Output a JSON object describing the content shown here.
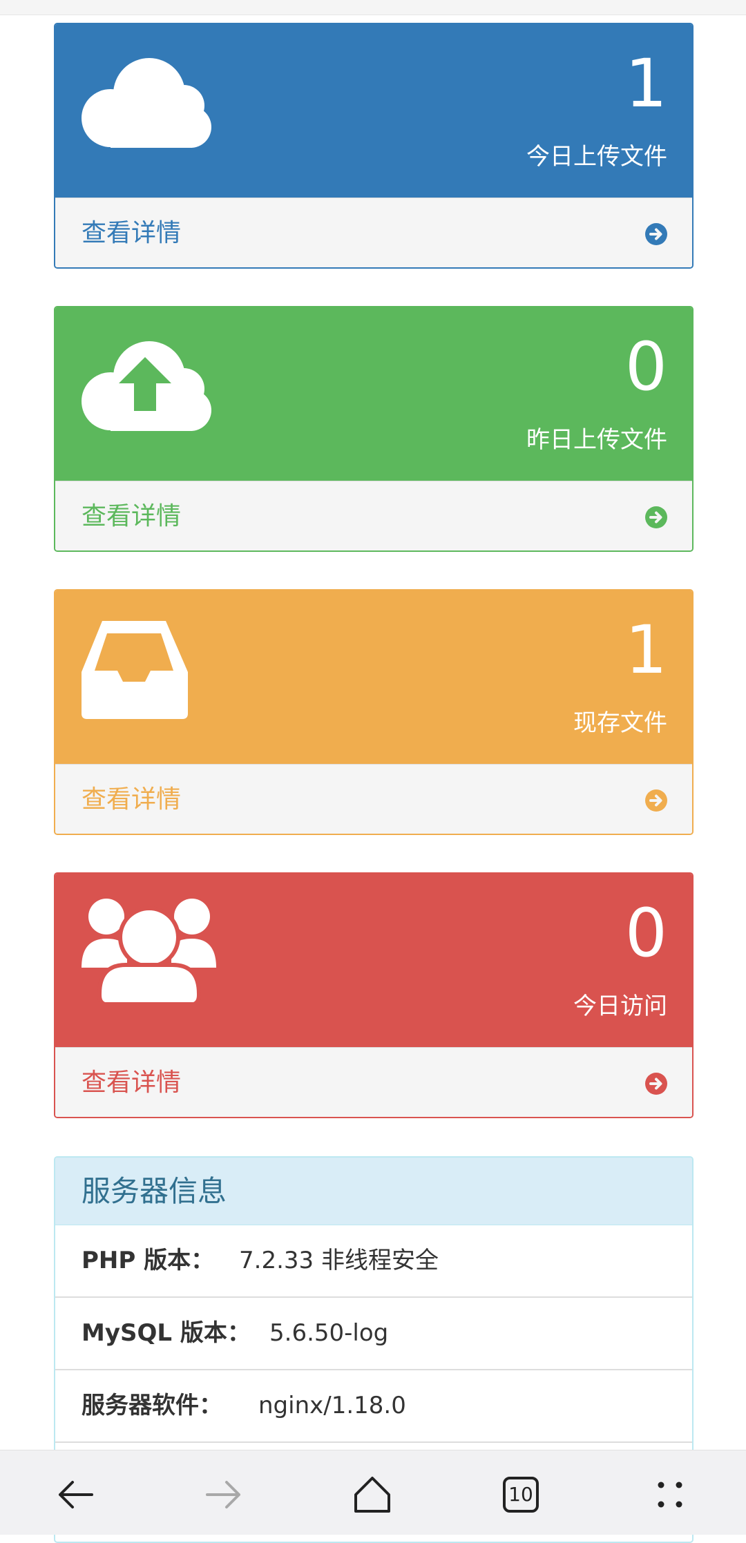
{
  "colors": {
    "blue": "#337ab7",
    "green": "#5cb85c",
    "orange": "#f0ad4e",
    "red": "#d9534f",
    "info_title": "#31708f"
  },
  "panels": [
    {
      "icon": "cloud-icon",
      "count": "1",
      "label": "今日上传文件",
      "link": "查看详情"
    },
    {
      "icon": "cloud-upload-icon",
      "count": "0",
      "label": "昨日上传文件",
      "link": "查看详情"
    },
    {
      "icon": "inbox-icon",
      "count": "1",
      "label": "现存文件",
      "link": "查看详情"
    },
    {
      "icon": "users-icon",
      "count": "0",
      "label": "今日访问",
      "link": "查看详情"
    }
  ],
  "server_info": {
    "title": "服务器信息",
    "rows": [
      {
        "key": "PHP 版本：",
        "value": "7.2.33 非线程安全"
      },
      {
        "key": "MySQL 版本：",
        "value": "5.6.50-log"
      },
      {
        "key": "服务器软件：",
        "value": "nginx/1.18.0"
      }
    ]
  },
  "browser_nav": {
    "icons": [
      "back-arrow-icon",
      "forward-arrow-icon",
      "home-icon",
      "tabs-icon",
      "menu-dots-icon"
    ],
    "tab_count": "10"
  }
}
